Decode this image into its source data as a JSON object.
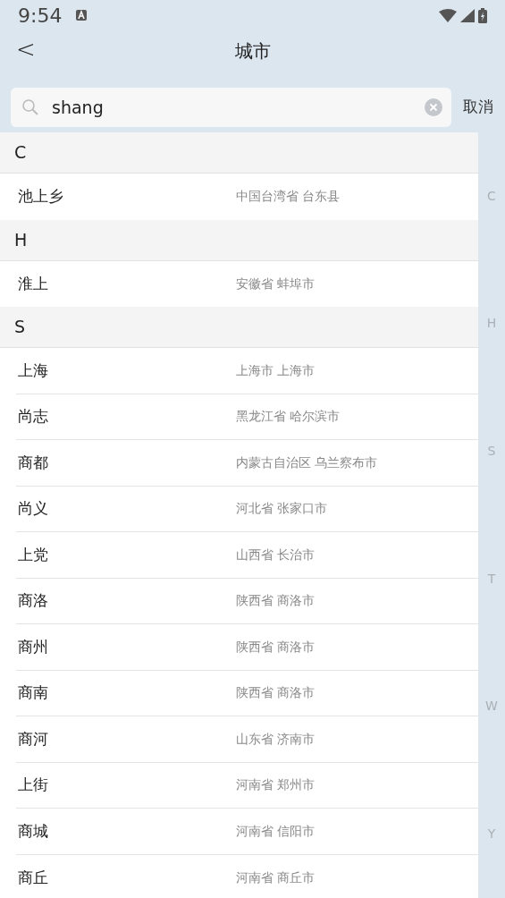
{
  "status_bar": {
    "time": "9:54"
  },
  "header": {
    "back": "<",
    "title": "城市"
  },
  "search": {
    "value": "shang",
    "cancel": "取消"
  },
  "sections": [
    {
      "letter": "C",
      "items": [
        {
          "name": "池上乡",
          "region": "中国台湾省 台东县"
        }
      ]
    },
    {
      "letter": "H",
      "items": [
        {
          "name": "淮上",
          "region": "安徽省 蚌埠市"
        }
      ]
    },
    {
      "letter": "S",
      "items": [
        {
          "name": "上海",
          "region": "上海市 上海市"
        },
        {
          "name": "尚志",
          "region": "黑龙江省 哈尔滨市"
        },
        {
          "name": "商都",
          "region": "内蒙古自治区 乌兰察布市"
        },
        {
          "name": "尚义",
          "region": "河北省 张家口市"
        },
        {
          "name": "上党",
          "region": "山西省 长治市"
        },
        {
          "name": "商洛",
          "region": "陕西省 商洛市"
        },
        {
          "name": "商州",
          "region": "陕西省 商洛市"
        },
        {
          "name": "商南",
          "region": "陕西省 商洛市"
        },
        {
          "name": "商河",
          "region": "山东省 济南市"
        },
        {
          "name": "上街",
          "region": "河南省 郑州市"
        },
        {
          "name": "商城",
          "region": "河南省 信阳市"
        },
        {
          "name": "商丘",
          "region": "河南省 商丘市"
        }
      ]
    }
  ],
  "index_letters": [
    "C",
    "H",
    "S",
    "T",
    "W",
    "Y"
  ]
}
